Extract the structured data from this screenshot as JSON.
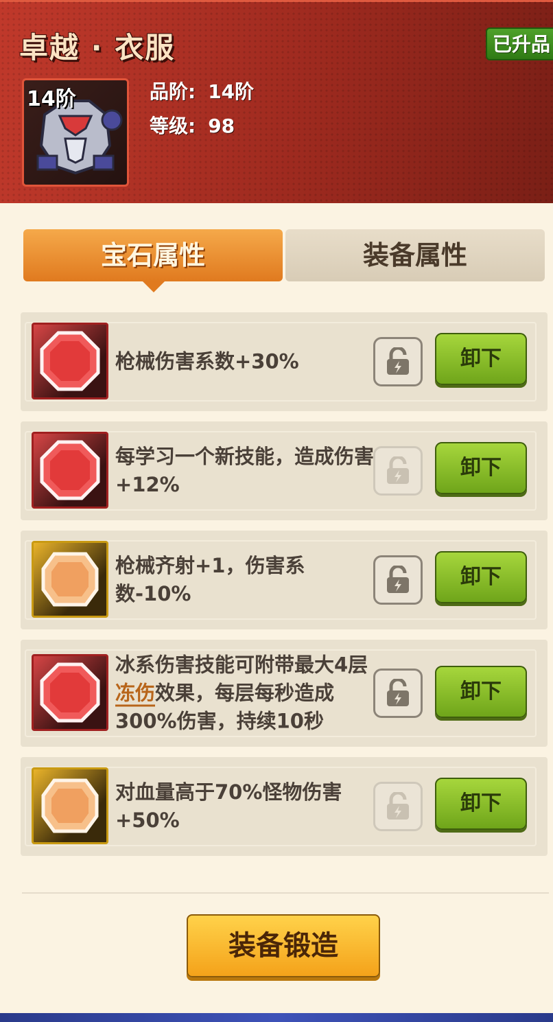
{
  "header": {
    "item_title": "卓越 · 衣服",
    "badge": "已升品",
    "tier_tag": "14阶",
    "quality_label": "品阶:",
    "quality_value": "14阶",
    "level_label": "等级:",
    "level_value": "98"
  },
  "tabs": [
    {
      "label": "宝石属性",
      "active": true
    },
    {
      "label": "装备属性",
      "active": false
    }
  ],
  "gems": [
    {
      "color": "red",
      "text": "枪械伤害系数+30%",
      "locked_dim": false,
      "unload_label": "卸下"
    },
    {
      "color": "red",
      "text": "每学习一个新技能，造成伤害+12%",
      "locked_dim": true,
      "unload_label": "卸下"
    },
    {
      "color": "gold",
      "text": "枪械齐射+1，伤害系数-10%",
      "locked_dim": false,
      "unload_label": "卸下"
    },
    {
      "color": "red",
      "text_before": "冰系伤害技能可附带最大4层",
      "text_highlight": "冻伤",
      "text_after": "效果，每层每秒造成300%伤害，持续10秒",
      "locked_dim": false,
      "unload_label": "卸下"
    },
    {
      "color": "gold",
      "text": "对血量高于70%怪物伤害+50%",
      "locked_dim": true,
      "unload_label": "卸下"
    }
  ],
  "forge_button": "装备锻造",
  "colors": {
    "header_red": "#9e2a1f",
    "active_tab_orange": "#e07a1f",
    "unload_green": "#8cc02a",
    "forge_gold": "#f4a21a"
  }
}
